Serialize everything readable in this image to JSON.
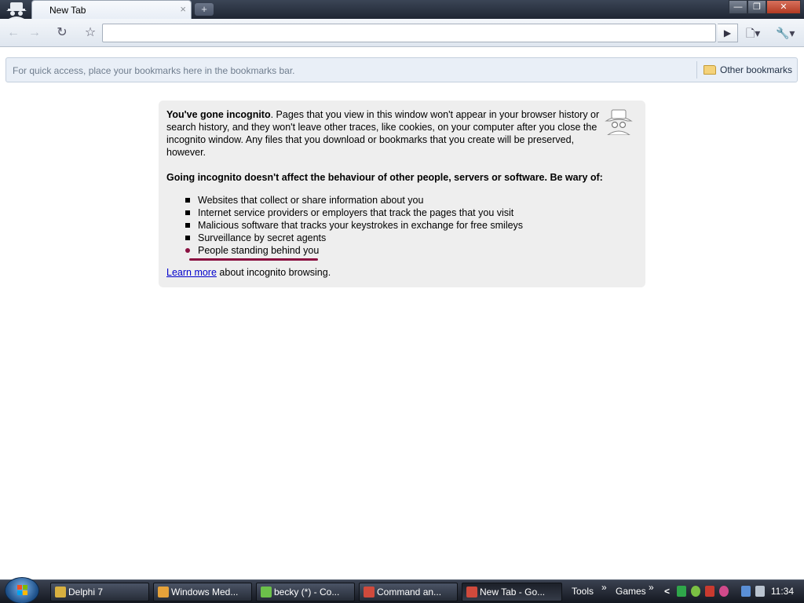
{
  "tab": {
    "title": "New Tab",
    "close_symbol": "×",
    "new_tab_symbol": "+"
  },
  "window": {
    "minimize": "—",
    "maximize": "❐",
    "close": "✕"
  },
  "toolbar": {
    "back_symbol": "←",
    "forward_symbol": "→",
    "reload_symbol": "↻",
    "star_symbol": "☆",
    "go_symbol": "▶",
    "page_menu_symbol": "▾",
    "wrench_symbol": "🔧▾",
    "omnibox_value": ""
  },
  "bookmarks_bar": {
    "hint": "For quick access, place your bookmarks here in the bookmarks bar.",
    "other_bookmarks": "Other bookmarks"
  },
  "incognito": {
    "intro_bold": "You've gone incognito",
    "intro_rest": ". Pages that you view in this window won't appear in your browser history or search history, and they won't leave other traces, like cookies, on your computer after you close the incognito window. Any files that you download or bookmarks that you create will be preserved, however.",
    "warning": "Going incognito doesn't affect the behaviour of other people, servers or software. Be wary of:",
    "items": [
      "Websites that collect or share information about you",
      "Internet service providers or employers that track the pages that you visit",
      "Malicious software that tracks your keystrokes in exchange for free smileys",
      "Surveillance by secret agents",
      "People standing behind you"
    ],
    "learn_more_link": "Learn more",
    "learn_more_rest": " about incognito browsing."
  },
  "taskbar": {
    "tasks": [
      {
        "label": "Delphi 7",
        "color": "#d8b040"
      },
      {
        "label": "Windows Med...",
        "color": "#e6a23a"
      },
      {
        "label": "becky (*) - Co...",
        "color": "#6cc14a"
      },
      {
        "label": "Command an...",
        "color": "#d04a3c"
      },
      {
        "label": "New Tab - Go...",
        "color": "#d04a3c"
      }
    ],
    "tools_label": "Tools",
    "games_label": "Games",
    "chevron": "»",
    "tray_arrow": "<",
    "clock": "11:34"
  },
  "colors": {
    "accent_underline": "#8a1040",
    "link": "#0000cc"
  }
}
